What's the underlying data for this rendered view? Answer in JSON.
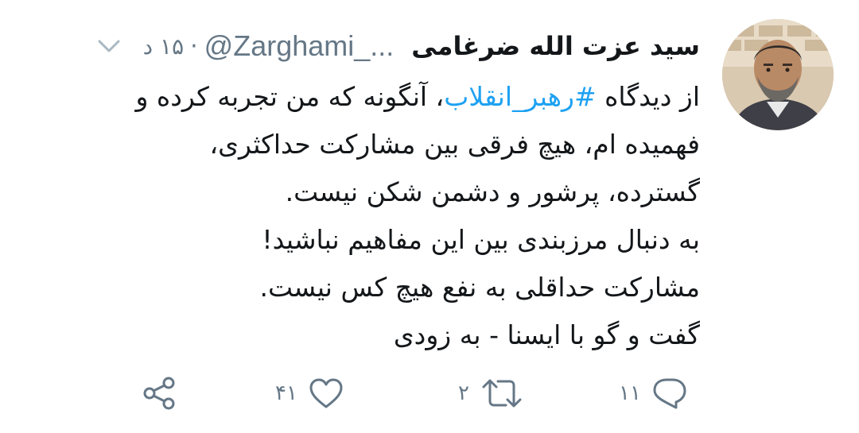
{
  "tweet": {
    "author": {
      "display_name": "سید عزت الله ضرغامی",
      "handle": "@Zarghami_...",
      "avatar_icon": "profile-photo"
    },
    "separator": "·",
    "timestamp": "۱۵ د",
    "text": {
      "line1_prefix": "از دیدگاه ",
      "hashtag": "#رهبر_انقلاب",
      "line1_suffix": "، آنگونه که من تجربه کرده و",
      "line2": "فهمیده ام، هیچ فرقی بین مشارکت حداکثری،",
      "line3": "گسترده، پرشور و دشمن شکن نیست.",
      "line4": " به دنبال مرزبندی بین این مفاهیم نباشید!",
      "line5": "مشارکت حداقلی به نفع هیچ کس نیست.",
      "line6": "گفت و گو با ایسنا - به زودی"
    },
    "actions": {
      "reply": {
        "icon": "reply-icon",
        "count": "۱۱"
      },
      "retweet": {
        "icon": "retweet-icon",
        "count": "۲"
      },
      "like": {
        "icon": "heart-icon",
        "count": "۴۱"
      },
      "share": {
        "icon": "share-icon"
      }
    },
    "colors": {
      "hashtag": "#1da1f2",
      "muted": "#657786",
      "text": "#14171a"
    }
  }
}
